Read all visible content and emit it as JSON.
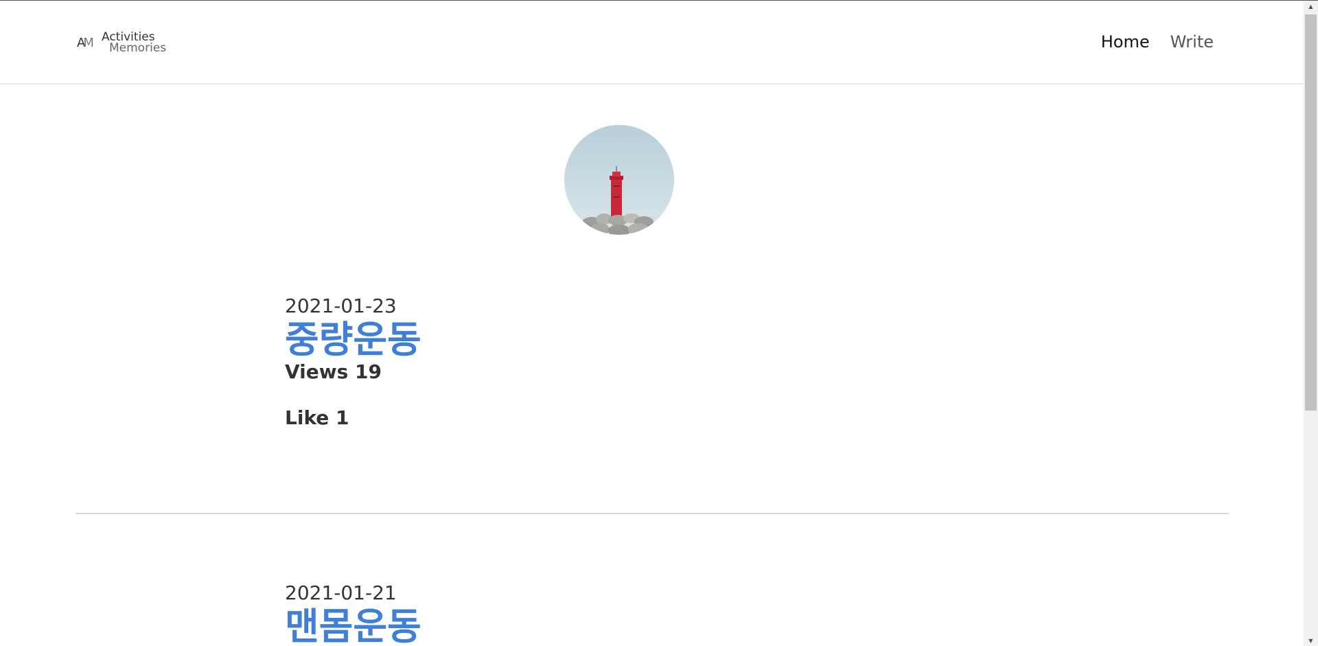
{
  "header": {
    "logo_mark_a": "A",
    "logo_mark_m": "M",
    "logo_line1": "Activities",
    "logo_line2": "Memories",
    "nav": {
      "home": "Home",
      "write": "Write"
    }
  },
  "avatar": {
    "alt": "lighthouse-photo"
  },
  "posts": [
    {
      "date": "2021-01-23",
      "title": "중량운동",
      "views": "Views 19",
      "likes": "Like 1"
    },
    {
      "date": "2021-01-21",
      "title": "맨몸운동"
    }
  ],
  "colors": {
    "title": "#3f7fd6",
    "text": "#333333",
    "divider": "#d9d9d9"
  },
  "icons": {
    "scroll_up": "scroll-up-arrow-icon",
    "scroll_down": "scroll-down-arrow-icon"
  }
}
